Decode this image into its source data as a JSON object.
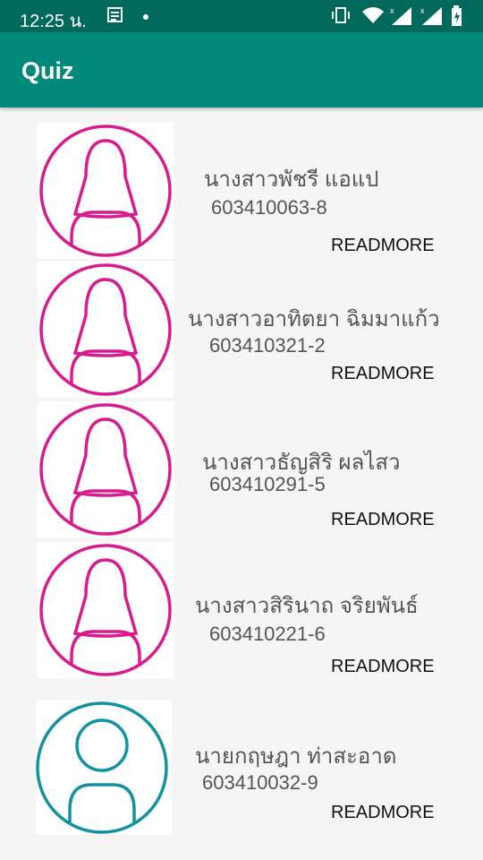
{
  "status_bar": {
    "time": "12:25 น.",
    "icons": [
      "news-icon",
      "dot-icon",
      "vibrate-icon",
      "wifi-icon",
      "signal-icon",
      "signal-icon",
      "battery-icon"
    ]
  },
  "app_bar": {
    "title": "Quiz"
  },
  "colors": {
    "app_bar": "#00897b",
    "status_bar": "#00695c",
    "female_avatar": "#d81b8e",
    "male_avatar": "#13939f"
  },
  "students": [
    {
      "name": "นางสาวพัชรี แอแป",
      "id": "603410063-8",
      "action": "READMORE",
      "avatar": "female-avatar-icon"
    },
    {
      "name": "นางสาวอาทิตยา ฉิมมาแก้ว",
      "id": "603410321-2",
      "action": "READMORE",
      "avatar": "female-avatar-icon"
    },
    {
      "name": "นางสาวธัญสิริ ผลไสว",
      "id": "603410291-5",
      "action": "READMORE",
      "avatar": "female-avatar-icon"
    },
    {
      "name": "นางสาวสิรินาถ จริยพันธ์",
      "id": "603410221-6",
      "action": "READMORE",
      "avatar": "female-avatar-icon"
    },
    {
      "name": "นายกฤษฎา ท่าสะอาด",
      "id": "603410032-9",
      "action": "READMORE",
      "avatar": "male-avatar-icon"
    }
  ]
}
